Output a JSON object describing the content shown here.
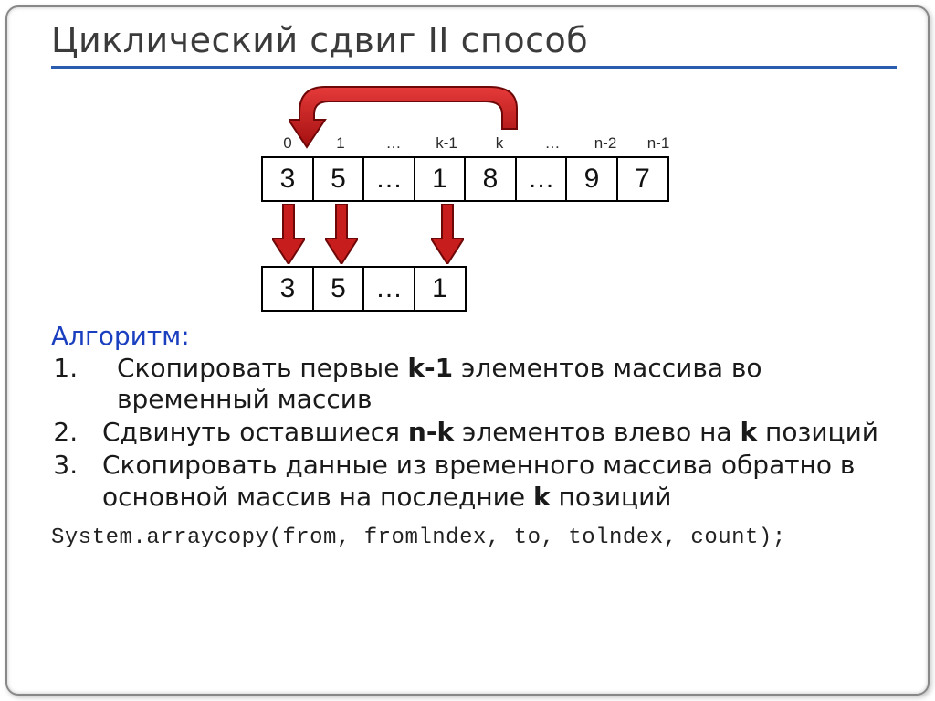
{
  "title": "Циклический сдвиг II способ",
  "indices": [
    "0",
    "1",
    "…",
    "k-1",
    "k",
    "…",
    "n-2",
    "n-1"
  ],
  "array_main": [
    "3",
    "5",
    "…",
    "1",
    "8",
    "…",
    "9",
    "7"
  ],
  "array_temp": [
    "3",
    "5",
    "…",
    "1"
  ],
  "algo_label": "Алгоритм:",
  "steps": [
    {
      "pre": "Скопировать первые ",
      "b1": "k-1",
      "mid1": " элементов массива во временный массив",
      "b2": "",
      "mid2": "",
      "b3": "",
      "tail": ""
    },
    {
      "pre": "Сдвинуть оставшиеся ",
      "b1": "n-k",
      "mid1": " элементов влево на ",
      "b2": "k",
      "mid2": " позиций",
      "b3": "",
      "tail": ""
    },
    {
      "pre": "Скопировать данные из временного массива обратно в основной массив на последние ",
      "b1": "k",
      "mid1": " позиций",
      "b2": "",
      "mid2": "",
      "b3": "",
      "tail": ""
    }
  ],
  "code_line": "System.arraycopy(from, fromlndex, to, tolndex, count);",
  "colors": {
    "arrow_fill": "#c81d1d",
    "arrow_stroke": "#7a0a0a"
  }
}
